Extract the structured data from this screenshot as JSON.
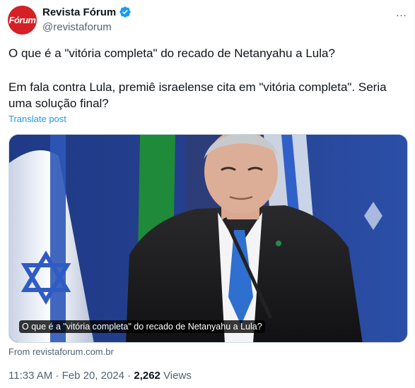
{
  "author": {
    "avatar_text": "Fórum",
    "display_name": "Revista Fórum",
    "handle": "@revistaforum"
  },
  "more_icon": "…",
  "tweet": {
    "line1": "O que é a \"vitória completa\" do recado de Netanyahu a Lula?",
    "line2": "Em fala contra Lula, premiê israelense cita em \"vitória completa\". Seria uma solução final?",
    "translate": "Translate post"
  },
  "card": {
    "caption": "O que é a \"vitória completa\" do recado de Netanyahu a Lula?",
    "source": "From revistaforum.com.br"
  },
  "meta": {
    "time": "11:33 AM",
    "sep1": " · ",
    "date": "Feb 20, 2024",
    "sep2": " · ",
    "views_count": "2,262",
    "views_label": " Views"
  },
  "colors": {
    "brand": "#d42026",
    "link": "#1d9bf0",
    "verified": "#1d9bf0",
    "secondary_text": "#536471"
  }
}
